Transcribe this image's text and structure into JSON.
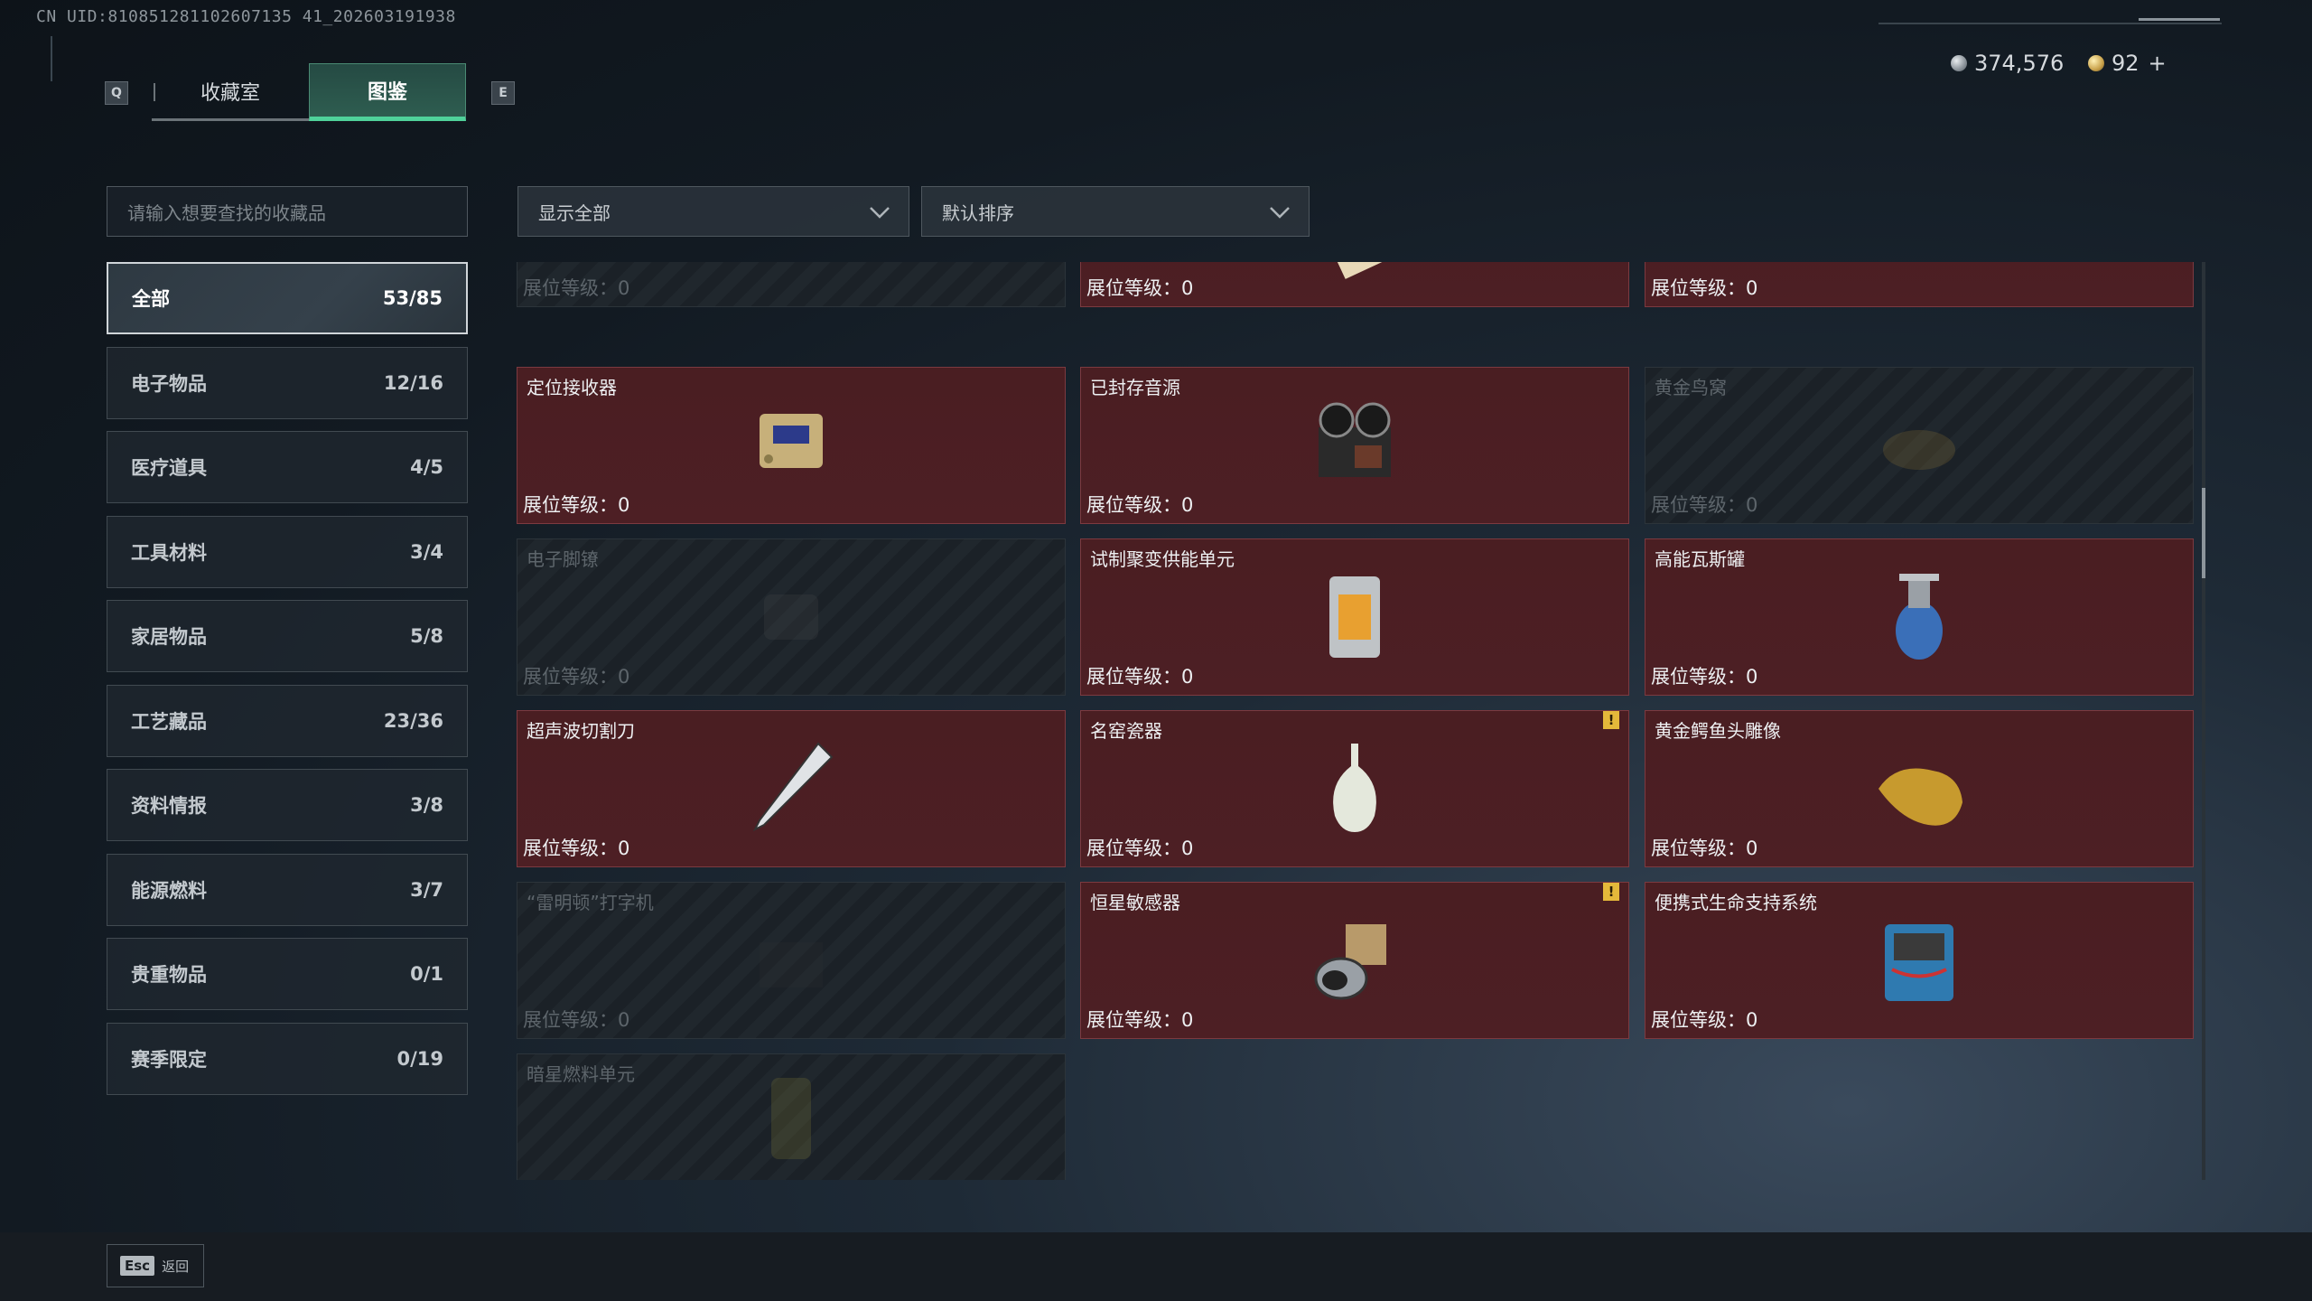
{
  "uid": "CN UID:810851281102607135 41_202603191938",
  "key_hints": {
    "left": "Q",
    "right": "E"
  },
  "tabs": [
    {
      "label": "收藏室"
    },
    {
      "label": "图鉴"
    }
  ],
  "currency": {
    "silver": "374,576",
    "gold": "92",
    "add": "+"
  },
  "search": {
    "placeholder": "请输入想要查找的收藏品"
  },
  "filters": {
    "show": "显示全部",
    "sort": "默认排序"
  },
  "categories": [
    {
      "label": "全部",
      "count": "53/85"
    },
    {
      "label": "电子物品",
      "count": "12/16"
    },
    {
      "label": "医疗道具",
      "count": "4/5"
    },
    {
      "label": "工具材料",
      "count": "3/4"
    },
    {
      "label": "家居物品",
      "count": "5/8"
    },
    {
      "label": "工艺藏品",
      "count": "23/36"
    },
    {
      "label": "资料情报",
      "count": "3/8"
    },
    {
      "label": "能源燃料",
      "count": "3/7"
    },
    {
      "label": "贵重物品",
      "count": "0/1"
    },
    {
      "label": "赛季限定",
      "count": "0/19"
    }
  ],
  "level_label": "展位等级：",
  "cards": [
    {
      "name": "",
      "level": "0",
      "owned": false,
      "icon": "locked-item-icon"
    },
    {
      "name": "",
      "level": "0",
      "owned": true,
      "icon": "painting-icon"
    },
    {
      "name": "",
      "level": "0",
      "owned": true,
      "icon": "framed-painting-icon"
    },
    {
      "name": "定位接收器",
      "level": "0",
      "owned": true,
      "icon": "receiver-icon"
    },
    {
      "name": "已封存音源",
      "level": "0",
      "owned": true,
      "icon": "tape-recorder-icon"
    },
    {
      "name": "黄金鸟窝",
      "level": "0",
      "owned": false,
      "icon": "bird-nest-icon"
    },
    {
      "name": "电子脚镣",
      "level": "0",
      "owned": false,
      "icon": "ankle-monitor-icon"
    },
    {
      "name": "试制聚变供能单元",
      "level": "0",
      "owned": true,
      "icon": "fusion-cell-icon"
    },
    {
      "name": "高能瓦斯罐",
      "level": "0",
      "owned": true,
      "icon": "gas-canister-icon"
    },
    {
      "name": "超声波切割刀",
      "level": "0",
      "owned": true,
      "icon": "ultrasonic-cutter-icon"
    },
    {
      "name": "名窑瓷器",
      "level": "0",
      "owned": true,
      "icon": "porcelain-vase-icon",
      "badge": "!"
    },
    {
      "name": "黄金鳄鱼头雕像",
      "level": "0",
      "owned": true,
      "icon": "gold-crocodile-icon"
    },
    {
      "name": "“雷明顿”打字机",
      "level": "0",
      "owned": false,
      "icon": "typewriter-icon"
    },
    {
      "name": "恒星敏感器",
      "level": "0",
      "owned": true,
      "icon": "star-sensor-icon",
      "badge": "!"
    },
    {
      "name": "便携式生命支持系统",
      "level": "0",
      "owned": true,
      "icon": "life-support-icon"
    },
    {
      "name": "暗星燃料单元",
      "level": "",
      "owned": false,
      "icon": "fuel-cell-icon"
    }
  ],
  "footer": {
    "esc_key": "Esc",
    "esc_label": "返回"
  }
}
